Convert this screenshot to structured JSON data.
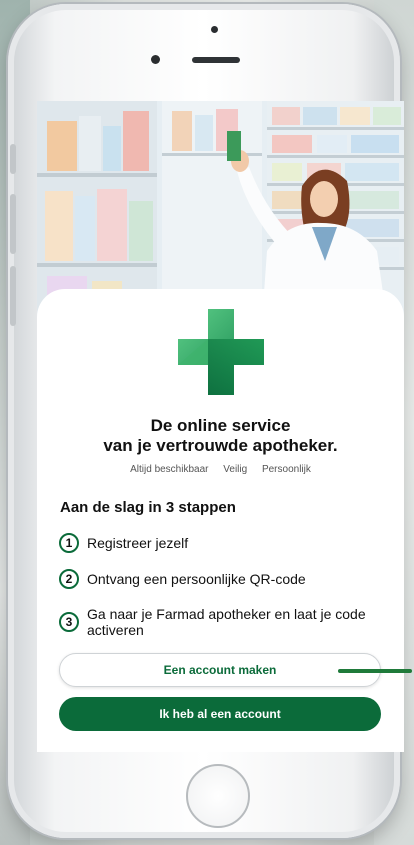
{
  "headline": {
    "line1": "De online service",
    "line2": "van je vertrouwde apotheker."
  },
  "tags": [
    "Altijd beschikbaar",
    "Veilig",
    "Persoonlijk"
  ],
  "steps_title": "Aan de slag in 3 stappen",
  "steps": [
    {
      "num": "1",
      "text": "Registreer jezelf"
    },
    {
      "num": "2",
      "text": "Ontvang een persoonlijke QR-code"
    },
    {
      "num": "3",
      "text": "Ga naar je Farmad apotheker en laat je code activeren"
    }
  ],
  "buttons": {
    "create_account": "Een account maken",
    "have_account": "Ik heb al een account"
  },
  "colors": {
    "brand_green": "#0b6b3a",
    "logo_green_light": "#4cc07a",
    "logo_green_dark": "#0b7a45"
  },
  "icons": {
    "logo": "pharmacy-cross-logo-icon"
  }
}
